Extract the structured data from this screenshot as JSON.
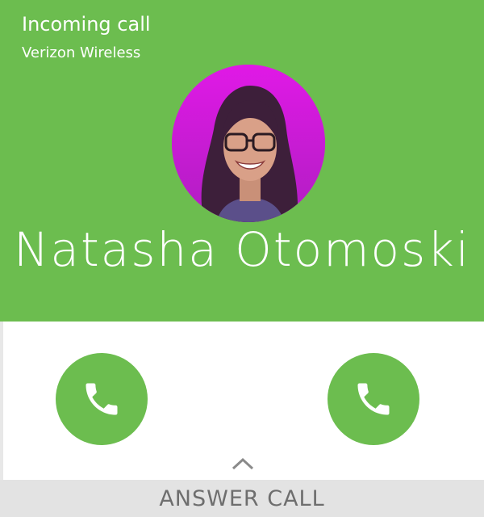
{
  "header": {
    "status_title": "Incoming call",
    "carrier": "Verizon Wireless"
  },
  "caller": {
    "name": "Natasha Otomoski",
    "avatar": "caller-photo"
  },
  "actions": {
    "left_button_icon": "phone-icon",
    "right_button_icon": "phone-icon",
    "swipe_hint_icon": "chevron-up-icon",
    "answer_label": "ANSWER CALL"
  },
  "colors": {
    "accent_green": "#6cbd4f",
    "avatar_background": "#d51ee0",
    "answer_bar": "#e3e3e3",
    "answer_text": "#6e6e6e"
  }
}
